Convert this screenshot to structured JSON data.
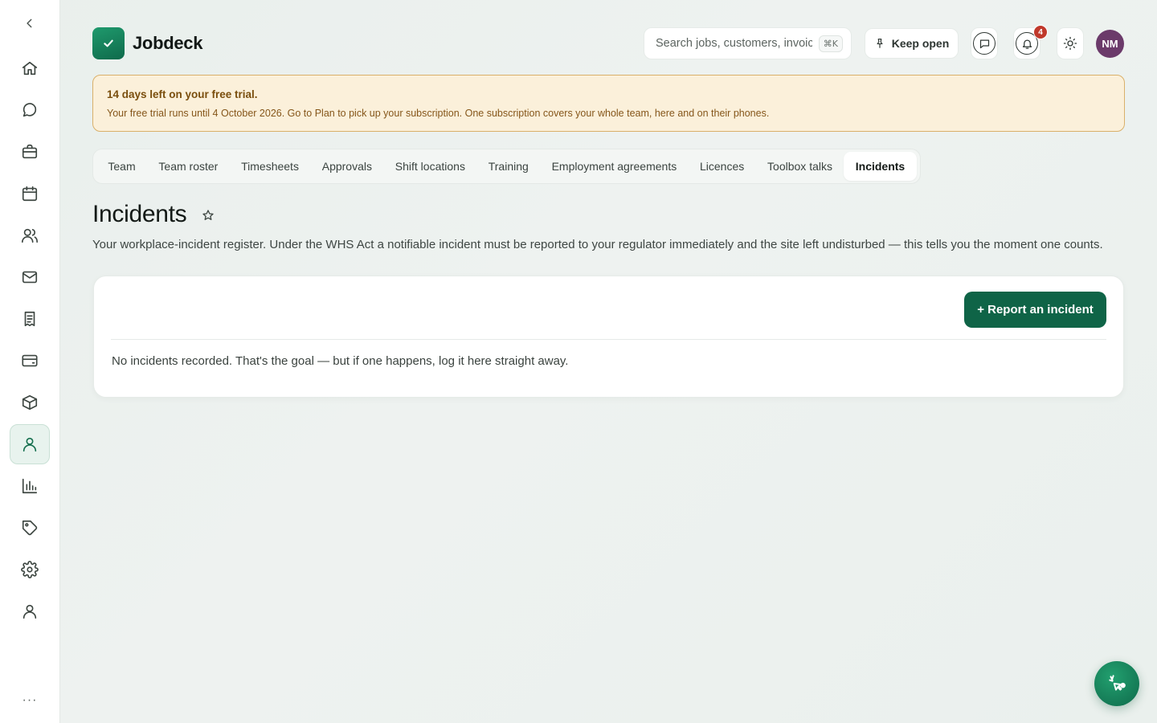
{
  "app": {
    "name": "Jobdeck"
  },
  "sidebar": {
    "items": [
      {
        "id": "home",
        "icon": "home-icon"
      },
      {
        "id": "messages",
        "icon": "chat-bubble-icon"
      },
      {
        "id": "jobs",
        "icon": "briefcase-icon"
      },
      {
        "id": "calendar",
        "icon": "calendar-icon"
      },
      {
        "id": "customers",
        "icon": "users-icon"
      },
      {
        "id": "mail",
        "icon": "mail-icon"
      },
      {
        "id": "invoices",
        "icon": "receipt-icon"
      },
      {
        "id": "payments",
        "icon": "credit-card-icon"
      },
      {
        "id": "inventory",
        "icon": "box-icon"
      },
      {
        "id": "team",
        "icon": "person-icon",
        "active": true
      },
      {
        "id": "reports",
        "icon": "bar-chart-icon"
      },
      {
        "id": "pricing",
        "icon": "tag-icon"
      },
      {
        "id": "settings",
        "icon": "gear-icon"
      },
      {
        "id": "account",
        "icon": "user-icon"
      }
    ],
    "more_label": "···"
  },
  "header": {
    "search": {
      "placeholder": "Search jobs, customers, invoices",
      "shortcut": "⌘K"
    },
    "keep_open_label": "Keep open",
    "notifications_count": "4",
    "avatar_initials": "NM"
  },
  "trial_banner": {
    "title": "14 days left on your free trial.",
    "body": "Your free trial runs until 4 October 2026. Go to Plan to pick up your subscription. One subscription covers your whole team, here and on their phones."
  },
  "tabs": [
    {
      "label": "Team"
    },
    {
      "label": "Team roster"
    },
    {
      "label": "Timesheets"
    },
    {
      "label": "Approvals"
    },
    {
      "label": "Shift locations"
    },
    {
      "label": "Training"
    },
    {
      "label": "Employment agreements"
    },
    {
      "label": "Licences"
    },
    {
      "label": "Toolbox talks"
    },
    {
      "label": "Incidents",
      "active": true
    }
  ],
  "page": {
    "title": "Incidents",
    "description": "Your workplace-incident register. Under the WHS Act a notifiable incident must be reported to your regulator immediately and the site left undisturbed — this tells you the moment one counts."
  },
  "card": {
    "report_button_label": "+ Report an incident",
    "empty_message": "No incidents recorded. That's the goal — but if one happens, log it here straight away."
  },
  "colors": {
    "brand": "#0f6447",
    "badge": "#c0392b",
    "avatar": "#6b3a6a",
    "trial_bg": "#fbf0da"
  }
}
